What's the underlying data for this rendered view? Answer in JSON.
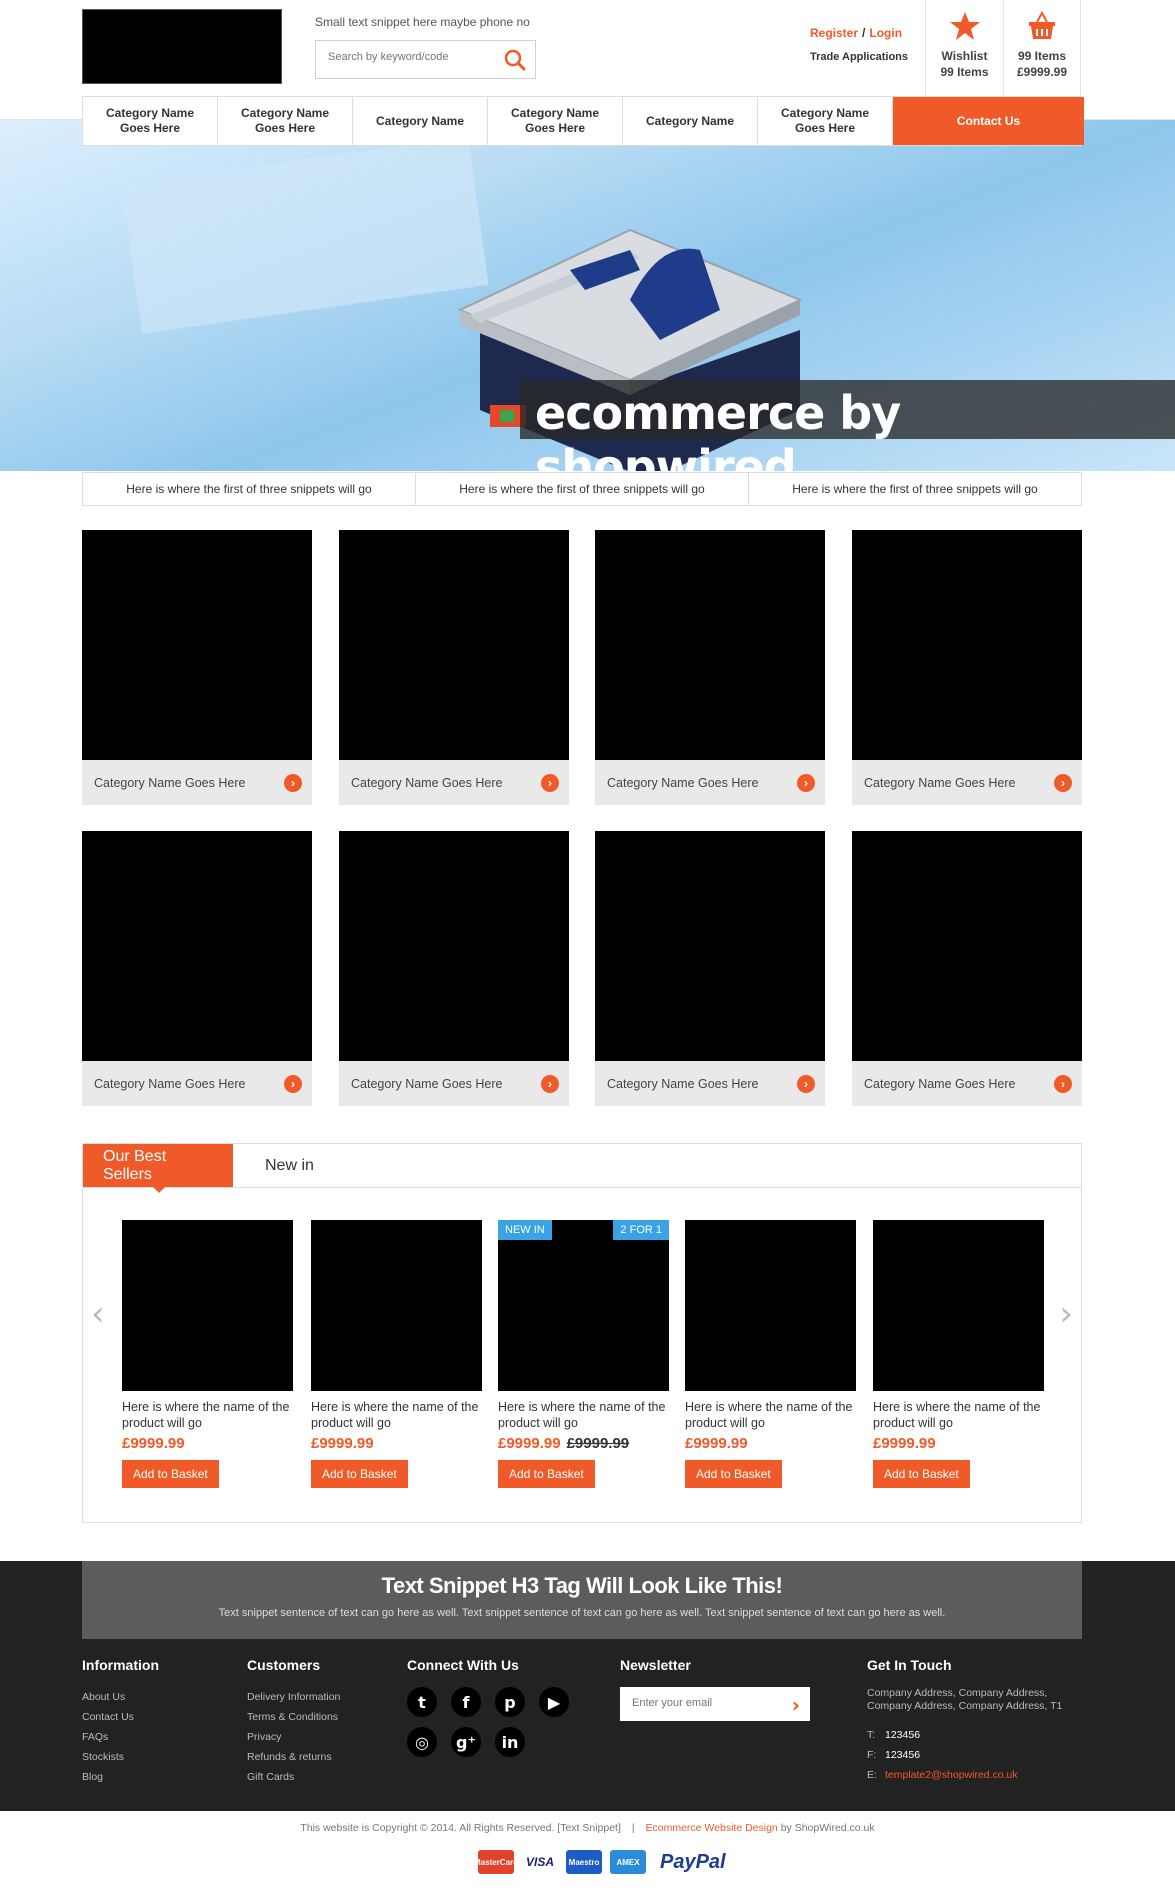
{
  "header": {
    "snippet": "Small text snippet here maybe phone no",
    "search_placeholder": "Search by keyword/code",
    "register": "Register",
    "login": "Login",
    "separator": "/",
    "trade": "Trade Applications",
    "wishlist_label": "Wishlist",
    "wishlist_count": "99 Items",
    "basket_count": "99 Items",
    "basket_total": "£9999.99"
  },
  "nav": [
    "Category Name Goes Here",
    "Category Name Goes Here",
    "Category Name",
    "Category Name Goes Here",
    "Category Name",
    "Category Name Goes Here",
    "Contact Us"
  ],
  "hero": {
    "caption": "ecommerce by shopwired"
  },
  "snippets": [
    "Here is where the first of three snippets will go",
    "Here is where the first of three snippets will go",
    "Here is where the first of three snippets will go"
  ],
  "categories": [
    "Category Name Goes Here",
    "Category Name Goes Here",
    "Category Name Goes Here",
    "Category Name Goes Here",
    "Category Name Goes Here",
    "Category Name Goes Here",
    "Category Name Goes Here",
    "Category Name Goes Here"
  ],
  "tabs": {
    "best": "Our Best Sellers",
    "new": "New in"
  },
  "carousel": {
    "prev": "‹",
    "next": "›"
  },
  "products": [
    {
      "name": "Here is where the name of the product will go",
      "price": "£9999.99",
      "button": "Add to Basket"
    },
    {
      "name": "Here is where the name of the product will go",
      "price": "£9999.99",
      "button": "Add to Basket"
    },
    {
      "name": "Here is where the name of the product will go",
      "price": "£9999.99",
      "was": "£9999.99",
      "badge_left": "NEW IN",
      "badge_right": "2 FOR 1",
      "button": "Add to Basket"
    },
    {
      "name": "Here is where the name of the product will go",
      "price": "£9999.99",
      "button": "Add to Basket"
    },
    {
      "name": "Here is where the name of the product will go",
      "price": "£9999.99",
      "button": "Add to Basket"
    }
  ],
  "footer": {
    "h3": "Text Snippet H3 Tag Will Look Like This!",
    "sentence": "Text snippet sentence of text can go here as well. Text snippet sentence of text can go here as well. Text snippet sentence of text can go here as well.",
    "information": {
      "title": "Information",
      "items": [
        "About Us",
        "Contact Us",
        "FAQs",
        "Stockists",
        "Blog"
      ]
    },
    "customers": {
      "title": "Customers",
      "items": [
        "Delivery Information",
        "Terms & Conditions",
        "Privacy",
        "Refunds & returns",
        "Gift Cards"
      ]
    },
    "connect": {
      "title": "Connect With Us"
    },
    "newsletter": {
      "title": "Newsletter",
      "placeholder": "Enter your email"
    },
    "touch": {
      "title": "Get In Touch",
      "address1": "Company Address, Company Address,",
      "address2": "Company Address, Company Address, T1",
      "t_label": "T:",
      "t_value": "123456",
      "f_label": "F:",
      "f_value": "123456",
      "e_label": "E:",
      "e_value": "template2@shopwired.co.uk"
    },
    "copyright": "This website is Copyright © 2014. All Rights Reserved. [Text Snippet]",
    "pipe": "|",
    "design_link": "Ecommerce Website Design",
    "design_by": "by ShopWired.co.uk",
    "payments": {
      "mastercard": "MasterCard",
      "visa": "VISA",
      "maestro": "Maestro",
      "amex": "AMEX",
      "paypal": "PayPal"
    }
  },
  "colors": {
    "accent": "#f05a28",
    "badge": "#3aa3e6",
    "footer_bg": "#222222"
  }
}
